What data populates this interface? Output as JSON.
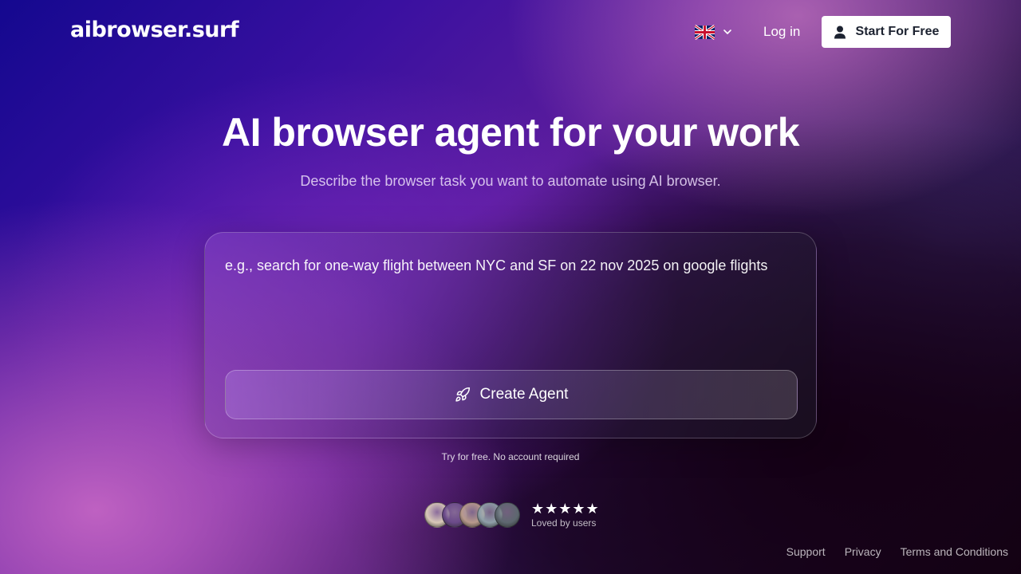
{
  "header": {
    "logo": "aibrowser.surf",
    "language_icon": "uk-flag-icon",
    "login_label": "Log in",
    "start_label": "Start For Free"
  },
  "hero": {
    "title": "AI browser agent for your work",
    "subtitle": "Describe the browser task you want to automate using AI browser."
  },
  "task_card": {
    "placeholder": "e.g., search for one-way flight between NYC and SF on 22 nov 2025 on google flights",
    "create_label": "Create Agent",
    "create_icon": "rocket-icon"
  },
  "note": "Try for free. No account required",
  "social_proof": {
    "stars": "★★★★★",
    "caption": "Loved by users",
    "avatar_colors": [
      "#d9c9b8",
      "#6b4a8a",
      "#b89a8c",
      "#8fa0a8",
      "#5e6870"
    ]
  },
  "footer": {
    "links": [
      "Support",
      "Privacy",
      "Terms and Conditions"
    ]
  },
  "colors": {
    "button_bg": "#ffffff",
    "button_text": "#1c2230"
  }
}
